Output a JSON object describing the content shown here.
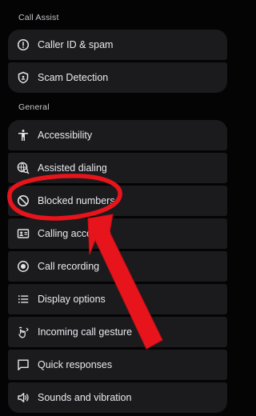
{
  "sections": [
    {
      "title": "Call Assist",
      "items": [
        {
          "label": "Caller ID & spam",
          "icon": "info-icon"
        },
        {
          "label": "Scam Detection",
          "icon": "shield-icon"
        }
      ]
    },
    {
      "title": "General",
      "items": [
        {
          "label": "Accessibility",
          "icon": "accessibility-icon"
        },
        {
          "label": "Assisted dialing",
          "icon": "globe-search-icon"
        },
        {
          "label": "Blocked numbers",
          "icon": "block-icon"
        },
        {
          "label": "Calling accounts",
          "icon": "account-card-icon"
        },
        {
          "label": "Call recording",
          "icon": "record-icon"
        },
        {
          "label": "Display options",
          "icon": "list-icon"
        },
        {
          "label": "Incoming call gesture",
          "icon": "gesture-icon"
        },
        {
          "label": "Quick responses",
          "icon": "message-icon"
        },
        {
          "label": "Sounds and vibration",
          "icon": "speaker-icon"
        }
      ]
    }
  ],
  "annotation": {
    "circle_color": "#e8141c",
    "arrow_color": "#e8141c",
    "highlighted_item": "Blocked numbers"
  }
}
